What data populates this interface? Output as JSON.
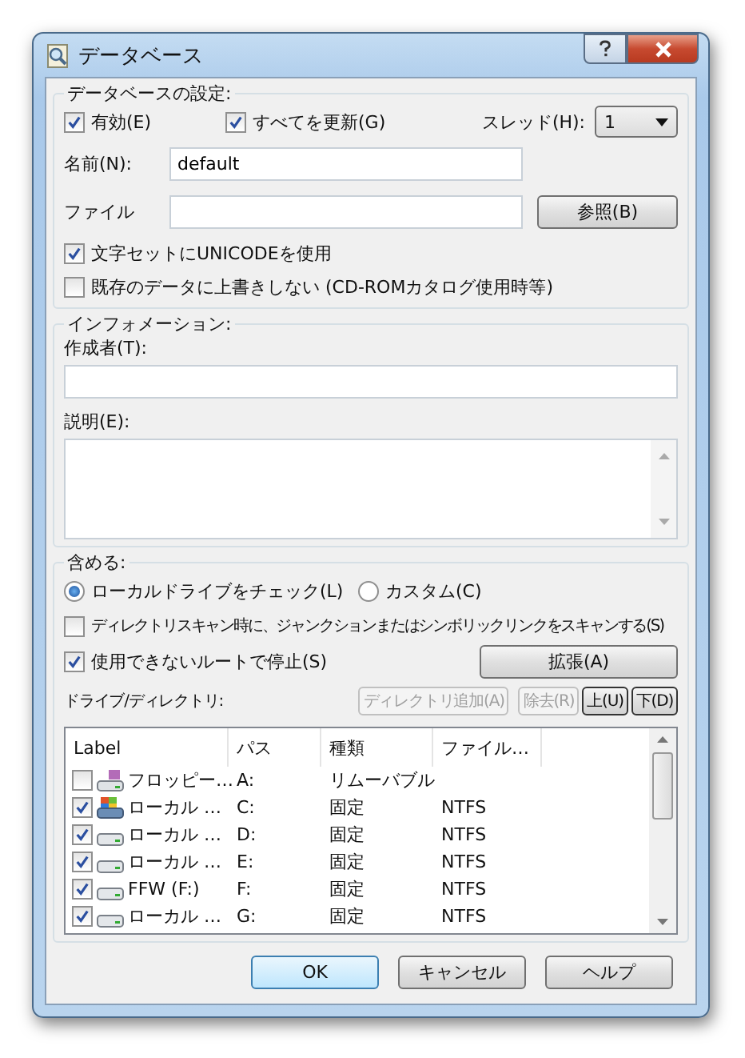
{
  "window": {
    "title": "データベース"
  },
  "db_settings": {
    "title": "データベースの設定:",
    "enabled": {
      "label": "有効(E)",
      "checked": true
    },
    "update_all": {
      "label": "すべてを更新(G)",
      "checked": true
    },
    "threads": {
      "label": "スレッド(H):",
      "value": "1"
    },
    "name": {
      "label": "名前(N):",
      "value": "default"
    },
    "file": {
      "label": "ファイル"
    },
    "browse_button": "参照(B)",
    "unicode": {
      "label": "文字セットにUNICODEを使用",
      "checked": true
    },
    "no_overwrite": {
      "label": "既存のデータに上書きしない (CD-ROMカタログ使用時等)",
      "checked": false
    }
  },
  "information": {
    "title": "インフォメーション:",
    "author_label": "作成者(T):",
    "description_label": "説明(E):"
  },
  "include": {
    "title": "含める:",
    "radios": [
      {
        "label": "ローカルドライブをチェック(L)",
        "selected": true
      },
      {
        "label": "カスタム(C)",
        "selected": false
      }
    ],
    "junction": {
      "label": "ディレクトリスキャン時に、ジャンクションまたはシンボリックリンクをスキャンする(S)",
      "checked": false
    },
    "stop": {
      "label": "使用できないルートで停止(S)",
      "checked": true
    },
    "extend_button": "拡張(A)",
    "drives_label": "ドライブ/ディレクトリ:",
    "buttons": [
      {
        "label": "ディレクトリ追加(A)",
        "disabled": true
      },
      {
        "label": "除去(R)",
        "disabled": true
      },
      {
        "label": "上(U)",
        "disabled": false
      },
      {
        "label": "下(D)",
        "disabled": false
      }
    ],
    "table": {
      "columns": [
        "Label",
        "パス",
        "種類",
        "ファイル…"
      ],
      "rows": [
        {
          "checked": false,
          "kind": "floppy",
          "label": "フロッピー…",
          "path": "A:",
          "type": "リムーバブル"
        },
        {
          "checked": true,
          "kind": "system",
          "label": "ローカル …",
          "path": "C:",
          "type": "固定",
          "fs": "NTFS"
        },
        {
          "checked": true,
          "kind": "disk",
          "label": "ローカル …",
          "path": "D:",
          "type": "固定",
          "fs": "NTFS"
        },
        {
          "checked": true,
          "kind": "disk",
          "label": "ローカル …",
          "path": "E:",
          "type": "固定",
          "fs": "NTFS"
        },
        {
          "checked": true,
          "kind": "disk",
          "label": "FFW (F:)",
          "path": "F:",
          "type": "固定",
          "fs": "NTFS"
        },
        {
          "checked": true,
          "kind": "disk",
          "label": "ローカル …",
          "path": "G:",
          "type": "固定",
          "fs": "NTFS"
        }
      ]
    }
  },
  "footer_buttons": [
    {
      "label": "OK",
      "default": true
    },
    {
      "label": "キャンセル",
      "default": false
    },
    {
      "label": "ヘルプ",
      "default": false
    }
  ]
}
